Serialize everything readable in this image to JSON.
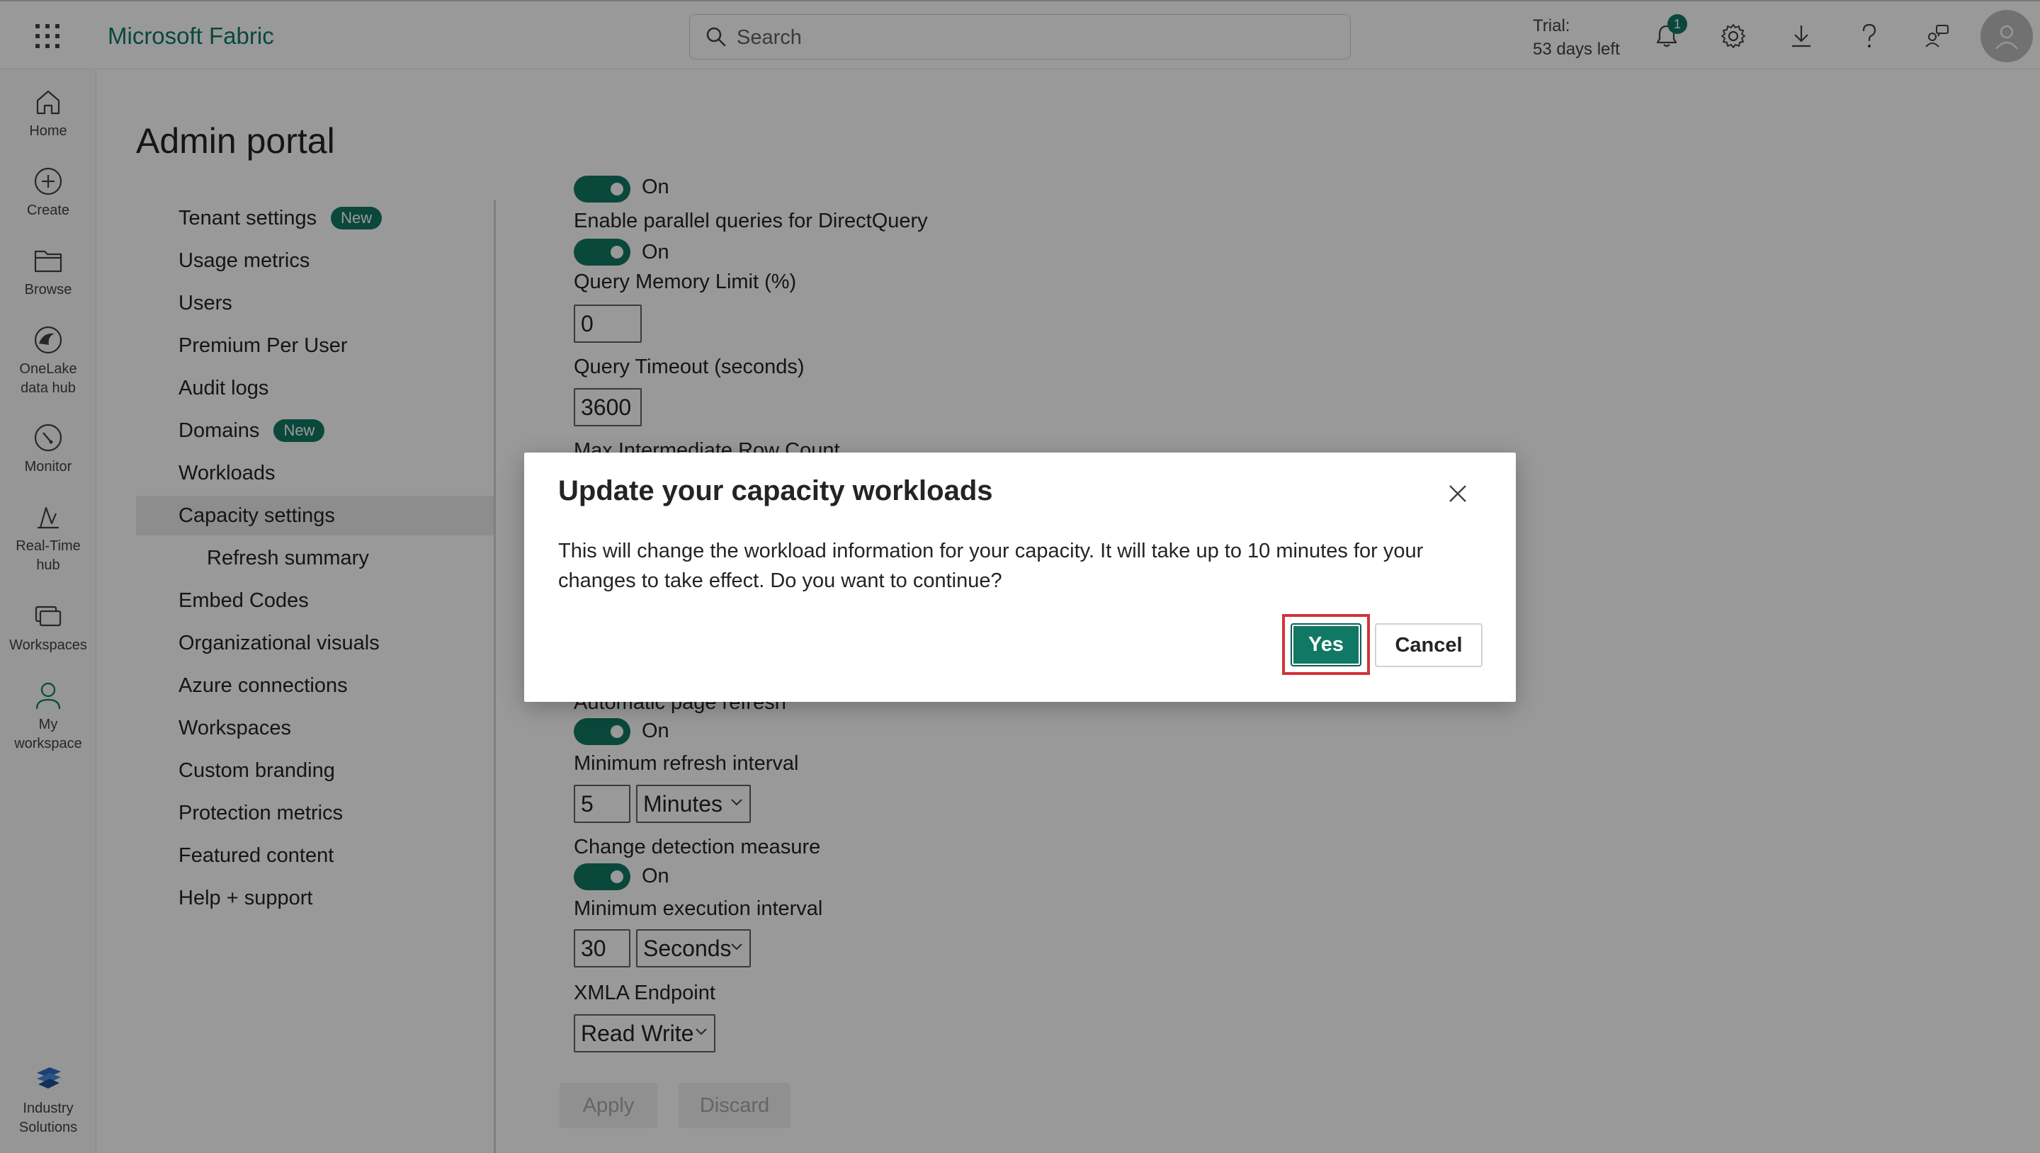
{
  "app": {
    "title": "Microsoft Fabric"
  },
  "search": {
    "placeholder": "Search"
  },
  "trial": {
    "line1": "Trial:",
    "line2": "53 days left"
  },
  "notifications": {
    "count": "1"
  },
  "rail": {
    "items": [
      {
        "label": "Home",
        "icon": "home-icon"
      },
      {
        "label": "Create",
        "icon": "plus-circle-icon"
      },
      {
        "label": "Browse",
        "icon": "folder-icon"
      },
      {
        "label": "OneLake data hub",
        "line1": "OneLake",
        "line2": "data hub",
        "icon": "onelake-icon"
      },
      {
        "label": "Monitor",
        "icon": "monitor-icon"
      },
      {
        "label": "Real-Time hub",
        "line1": "Real-Time",
        "line2": "hub",
        "icon": "realtime-icon"
      },
      {
        "label": "Workspaces",
        "icon": "workspaces-icon"
      },
      {
        "label": "My workspace",
        "line1": "My",
        "line2": "workspace",
        "icon": "person-icon"
      }
    ],
    "bottom": {
      "line1": "Industry",
      "line2": "Solutions",
      "icon": "industry-solutions-icon"
    }
  },
  "page": {
    "title": "Admin portal"
  },
  "nav": {
    "items": [
      {
        "label": "Tenant settings",
        "badge": "New"
      },
      {
        "label": "Usage metrics"
      },
      {
        "label": "Users"
      },
      {
        "label": "Premium Per User"
      },
      {
        "label": "Audit logs"
      },
      {
        "label": "Domains",
        "badge": "New"
      },
      {
        "label": "Workloads"
      },
      {
        "label": "Capacity settings",
        "selected": true
      },
      {
        "label": "Refresh summary",
        "sub": true
      },
      {
        "label": "Embed Codes"
      },
      {
        "label": "Organizational visuals"
      },
      {
        "label": "Azure connections"
      },
      {
        "label": "Workspaces"
      },
      {
        "label": "Custom branding"
      },
      {
        "label": "Protection metrics"
      },
      {
        "label": "Featured content"
      },
      {
        "label": "Help + support"
      }
    ]
  },
  "settings": {
    "top_toggle_text": "On",
    "parallel_queries": {
      "label": "Enable parallel queries for DirectQuery",
      "state": "On"
    },
    "query_memory": {
      "label": "Query Memory Limit (%)",
      "value": "0"
    },
    "query_timeout": {
      "label": "Query Timeout (seconds)",
      "value": "3600"
    },
    "max_intermediate": {
      "label": "Max Intermediate Row Count"
    },
    "auto_refresh": {
      "label": "Automatic page refresh",
      "state": "On"
    },
    "min_refresh": {
      "label": "Minimum refresh interval",
      "value": "5",
      "unit": "Minutes"
    },
    "change_detection": {
      "label": "Change detection measure",
      "state": "On"
    },
    "min_execution": {
      "label": "Minimum execution interval",
      "value": "30",
      "unit": "Seconds"
    },
    "xmla": {
      "label": "XMLA Endpoint",
      "value": "Read Write"
    },
    "apply_label": "Apply",
    "discard_label": "Discard"
  },
  "dialog": {
    "title": "Update your capacity workloads",
    "body": "This will change the workload information for your capacity. It will take up to 10 minutes for your changes to take effect. Do you want to continue?",
    "yes_label": "Yes",
    "cancel_label": "Cancel"
  },
  "colors": {
    "accent": "#117865",
    "highlight": "#d13438"
  }
}
